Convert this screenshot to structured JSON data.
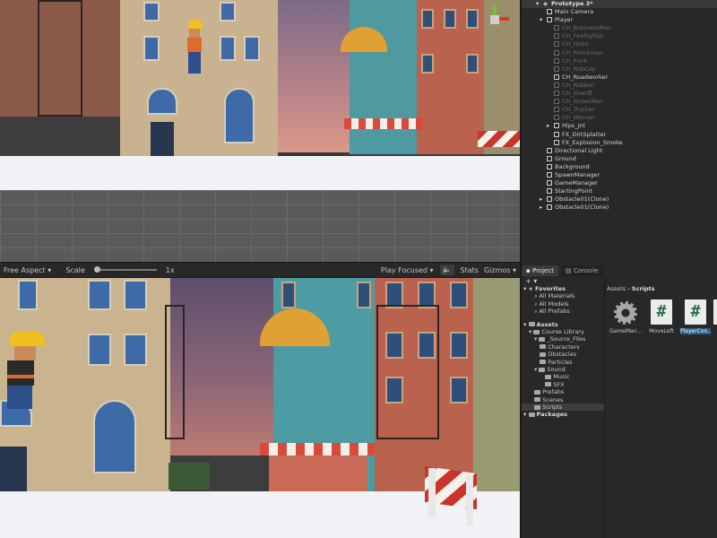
{
  "hierarchy": {
    "root": "Prototype 3*",
    "items": [
      {
        "label": "Main Camera",
        "depth": 1,
        "dim": false,
        "expander": false
      },
      {
        "label": "Player",
        "depth": 1,
        "dim": false,
        "expander": true
      },
      {
        "label": "CH_BusinessMan",
        "depth": 2,
        "dim": true,
        "expander": false
      },
      {
        "label": "CH_FireFighter",
        "depth": 2,
        "dim": true,
        "expander": false
      },
      {
        "label": "CH_Hobo",
        "depth": 2,
        "dim": true,
        "expander": false
      },
      {
        "label": "CH_Policeman",
        "depth": 2,
        "dim": true,
        "expander": false
      },
      {
        "label": "CH_Punk",
        "depth": 2,
        "dim": true,
        "expander": false
      },
      {
        "label": "CH_RobCop",
        "depth": 2,
        "dim": true,
        "expander": false
      },
      {
        "label": "CH_Roadworker",
        "depth": 2,
        "dim": false,
        "expander": false
      },
      {
        "label": "CH_Robber",
        "depth": 2,
        "dim": true,
        "expander": false
      },
      {
        "label": "CH_Sheriff",
        "depth": 2,
        "dim": true,
        "expander": false
      },
      {
        "label": "CH_StreetMan",
        "depth": 2,
        "dim": true,
        "expander": false
      },
      {
        "label": "CH_Trucker",
        "depth": 2,
        "dim": true,
        "expander": false
      },
      {
        "label": "CH_Woman",
        "depth": 2,
        "dim": true,
        "expander": false
      },
      {
        "label": "Hips_jnt",
        "depth": 2,
        "dim": false,
        "expander": true
      },
      {
        "label": "FX_DirtSplatter",
        "depth": 2,
        "dim": false,
        "expander": false
      },
      {
        "label": "FX_Explosion_Smoke",
        "depth": 2,
        "dim": false,
        "expander": false
      },
      {
        "label": "Directional Light",
        "depth": 1,
        "dim": false,
        "expander": false
      },
      {
        "label": "Ground",
        "depth": 1,
        "dim": false,
        "expander": false
      },
      {
        "label": "Background",
        "depth": 1,
        "dim": false,
        "expander": false
      },
      {
        "label": "SpawnManager",
        "depth": 1,
        "dim": false,
        "expander": false
      },
      {
        "label": "GameManager",
        "depth": 1,
        "dim": false,
        "expander": false
      },
      {
        "label": "StartingPoint",
        "depth": 1,
        "dim": false,
        "expander": false
      },
      {
        "label": "Obstacle01(Clone)",
        "depth": 1,
        "dim": false,
        "expander": true
      },
      {
        "label": "Obstacle01(Clone)",
        "depth": 1,
        "dim": false,
        "expander": true
      }
    ]
  },
  "game_toolbar": {
    "aspect": "Free Aspect",
    "scale_label": "Scale",
    "scale_value": "1x",
    "play_mode": "Play Focused",
    "stats": "Stats",
    "gizmos": "Gizmos"
  },
  "project": {
    "tabs": [
      "Project",
      "Console"
    ],
    "add_button": "+ ▾",
    "breadcrumb": [
      "Assets",
      "Scripts"
    ],
    "tree": [
      {
        "label": "Favorites",
        "depth": 0,
        "bold": true,
        "icon": "star-icon",
        "expander": true
      },
      {
        "label": "All Materials",
        "depth": 1,
        "bold": false,
        "icon": "search-icon",
        "expander": false
      },
      {
        "label": "All Models",
        "depth": 1,
        "bold": false,
        "icon": "search-icon",
        "expander": false
      },
      {
        "label": "All Prefabs",
        "depth": 1,
        "bold": false,
        "icon": "search-icon",
        "expander": false
      },
      {
        "label": "Assets",
        "depth": 0,
        "bold": true,
        "icon": "folder-icon",
        "expander": true
      },
      {
        "label": "Course Library",
        "depth": 1,
        "bold": false,
        "icon": "folder-icon",
        "expander": true
      },
      {
        "label": "_Source_Files",
        "depth": 2,
        "bold": false,
        "icon": "folder-icon",
        "expander": true
      },
      {
        "label": "Characters",
        "depth": 2,
        "bold": false,
        "icon": "folder-icon",
        "expander": false
      },
      {
        "label": "Obstacles",
        "depth": 2,
        "bold": false,
        "icon": "folder-icon",
        "expander": false
      },
      {
        "label": "Particles",
        "depth": 2,
        "bold": false,
        "icon": "folder-icon",
        "expander": false
      },
      {
        "label": "Sound",
        "depth": 2,
        "bold": false,
        "icon": "folder-icon",
        "expander": true
      },
      {
        "label": "Music",
        "depth": 3,
        "bold": false,
        "icon": "folder-icon",
        "expander": false
      },
      {
        "label": "SFX",
        "depth": 3,
        "bold": false,
        "icon": "folder-icon",
        "expander": false
      },
      {
        "label": "Prefabs",
        "depth": 1,
        "bold": false,
        "icon": "folder-icon",
        "expander": false
      },
      {
        "label": "Scenes",
        "depth": 1,
        "bold": false,
        "icon": "folder-icon",
        "expander": false
      },
      {
        "label": "Scripts",
        "depth": 1,
        "bold": false,
        "icon": "folder-icon",
        "expander": false,
        "selected": true
      },
      {
        "label": "Packages",
        "depth": 0,
        "bold": true,
        "icon": "folder-icon",
        "expander": true
      }
    ],
    "assets": [
      {
        "label": "GameMan...",
        "type": "gear-icon"
      },
      {
        "label": "MoveLeft",
        "type": "csharp-script-icon"
      },
      {
        "label": "PlayerCon...",
        "type": "csharp-script-icon",
        "selected": true
      }
    ]
  },
  "colors": {
    "panel_bg": "#282828",
    "selection": "#2c5d87",
    "script_hash": "#27704b"
  }
}
